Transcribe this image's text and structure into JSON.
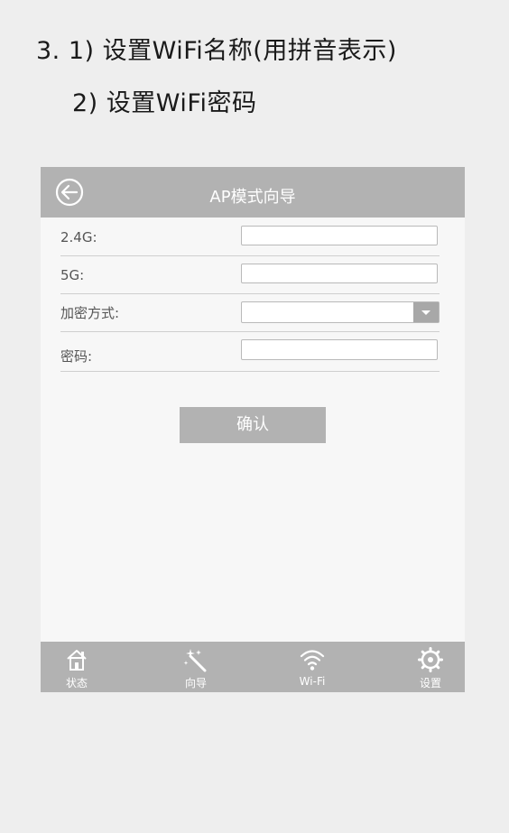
{
  "instructions": {
    "line1": "3. 1) 设置WiFi名称(用拼音表示)",
    "line2": "2) 设置WiFi密码"
  },
  "header": {
    "title": "AP模式向导",
    "back_icon": "back-arrow-circle-icon"
  },
  "form": {
    "fields": [
      {
        "label": "2.4G:",
        "value": ""
      },
      {
        "label": "5G:",
        "value": ""
      },
      {
        "label": "加密方式:",
        "value": ""
      },
      {
        "label": "密码:",
        "value": ""
      }
    ],
    "confirm_label": "确认"
  },
  "bottom_nav": [
    {
      "label": "状态",
      "icon": "home-icon"
    },
    {
      "label": "向导",
      "icon": "magic-wand-icon"
    },
    {
      "label": "Wi-Fi",
      "icon": "wifi-icon"
    },
    {
      "label": "设置",
      "icon": "gear-icon"
    }
  ],
  "colors": {
    "bar_gray": "#b2b2b2",
    "panel_bg": "#f7f7f7",
    "page_bg": "#eeeeee"
  }
}
